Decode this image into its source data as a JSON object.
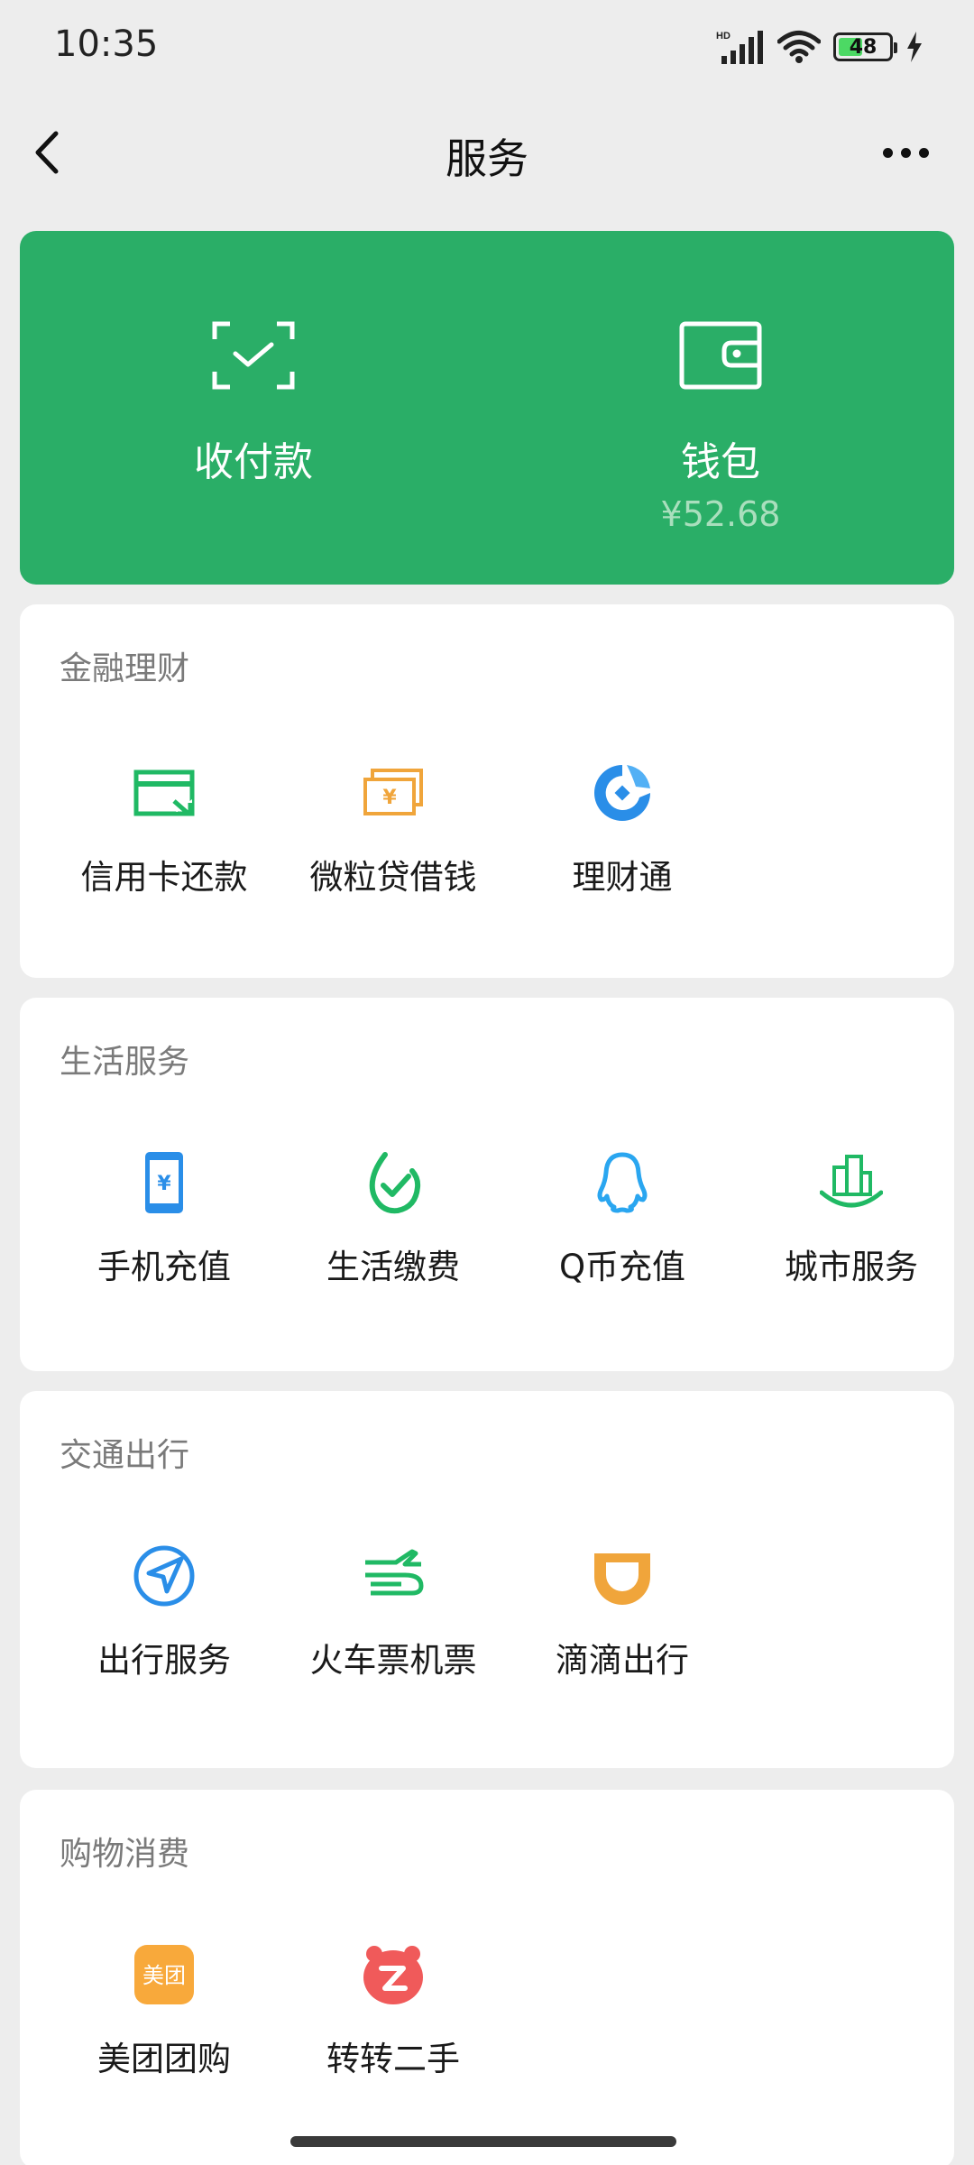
{
  "status": {
    "time": "10:35",
    "battery": "48",
    "battery_level": 0.48,
    "network": "HD"
  },
  "nav": {
    "title": "服务"
  },
  "pay_card": {
    "left_label": "收付款",
    "right_label": "钱包",
    "balance": "¥52.68"
  },
  "sections": [
    {
      "title": "金融理财",
      "items": [
        {
          "label": "信用卡还款",
          "icon": "credit-card-repay-icon"
        },
        {
          "label": "微粒贷借钱",
          "icon": "loan-icon"
        },
        {
          "label": "理财通",
          "icon": "wealth-icon"
        }
      ]
    },
    {
      "title": "生活服务",
      "items": [
        {
          "label": "手机充值",
          "icon": "phone-topup-icon"
        },
        {
          "label": "生活缴费",
          "icon": "utility-bill-icon"
        },
        {
          "label": "Q币充值",
          "icon": "qq-coin-icon"
        },
        {
          "label": "城市服务",
          "icon": "city-service-icon"
        }
      ]
    },
    {
      "title": "交通出行",
      "items": [
        {
          "label": "出行服务",
          "icon": "navigation-icon"
        },
        {
          "label": "火车票机票",
          "icon": "train-plane-icon"
        },
        {
          "label": "滴滴出行",
          "icon": "didi-icon"
        }
      ]
    },
    {
      "title": "购物消费",
      "items": [
        {
          "label": "美团团购",
          "icon": "meituan-icon",
          "icon_text": "美团"
        },
        {
          "label": "转转二手",
          "icon": "zhuanzhuan-icon"
        }
      ]
    }
  ],
  "colors": {
    "brand_green": "#2aae67",
    "icon_green": "#20b964",
    "icon_orange": "#f0a53b",
    "icon_blue": "#2a8ee8",
    "icon_red": "#f05a5a"
  }
}
